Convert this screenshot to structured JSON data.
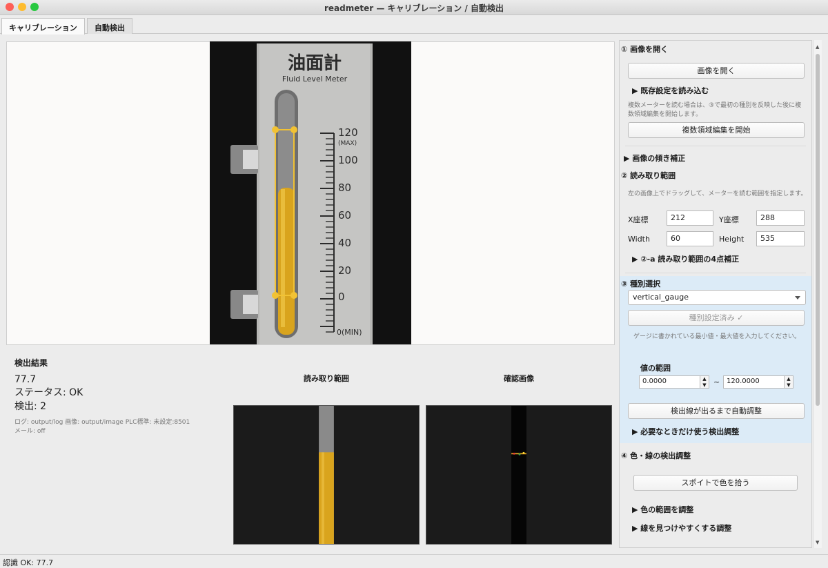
{
  "window": {
    "title": "readmeter — キャリブレーション / 自動検出"
  },
  "tabs": [
    {
      "label": "キャリブレーション",
      "active": true
    },
    {
      "label": "自動検出",
      "active": false
    }
  ],
  "gauge_image": {
    "title_jp": "油面計",
    "title_en": "Fluid Level Meter",
    "scale_labels": [
      "120",
      "(MAX)",
      "100",
      "80",
      "60",
      "40",
      "20",
      "0",
      "0(MIN)"
    ]
  },
  "results": {
    "heading": "検出結果",
    "value": "77.7",
    "status": "ステータス: OK",
    "count": "検出: 2",
    "log_line1": "ログ: output/log  画像: output/image  PLC標準: 未設定:8501",
    "log_line2": "メール: off"
  },
  "previews": {
    "roi_title": "読み取り範囲",
    "confirm_title": "確認画像"
  },
  "panel": {
    "s1_title": "① 画像を開く",
    "open_button": "画像を開く",
    "load_settings": "▶ 既存設定を読み込む",
    "multi_note": "複数メーターを読む場合は、③で最初の種別を反映した後に複数領域編集を開始します。",
    "multi_button": "複数領域編集を開始",
    "tilt": "▶ 画像の傾き補正",
    "s2_title": "② 読み取り範囲",
    "roi_note": "左の画像上でドラッグして、メーターを読む範囲を指定します。",
    "x_label": "X座標",
    "x_value": "212",
    "y_label": "Y座標",
    "y_value": "288",
    "w_label": "Width",
    "w_value": "60",
    "h_label": "Height",
    "h_value": "535",
    "four_point": "▶ ②-a 読み取り範囲の4点補正",
    "s3_title": "③ 種別選択",
    "type_value": "vertical_gauge",
    "type_set_button": "種別設定済み ✓",
    "range_note": "ゲージに書かれている最小値・最大値を入力してください。",
    "range_label": "値の範囲",
    "min_value": "0.0000",
    "range_sep": "~",
    "max_value": "120.0000",
    "auto_adjust_button": "検出線が出るまで自動調整",
    "detect_adjust": "▶ 必要なときだけ使う検出調整",
    "s4_title": "④ 色・線の検出調整",
    "eyedropper_button": "スポイトで色を拾う",
    "color_range": "▶ 色の範囲を調整",
    "line_adjust": "▶ 線を見つけやすくする調整"
  },
  "status": {
    "text": "認識 OK: 77.7"
  },
  "colors": {
    "accent_gold": "#f2c233",
    "oil": "#d9a41d",
    "close": "#fe5f57",
    "minimize": "#febc2e",
    "zoom": "#28c840",
    "section3_bg": "#dcebf7"
  }
}
